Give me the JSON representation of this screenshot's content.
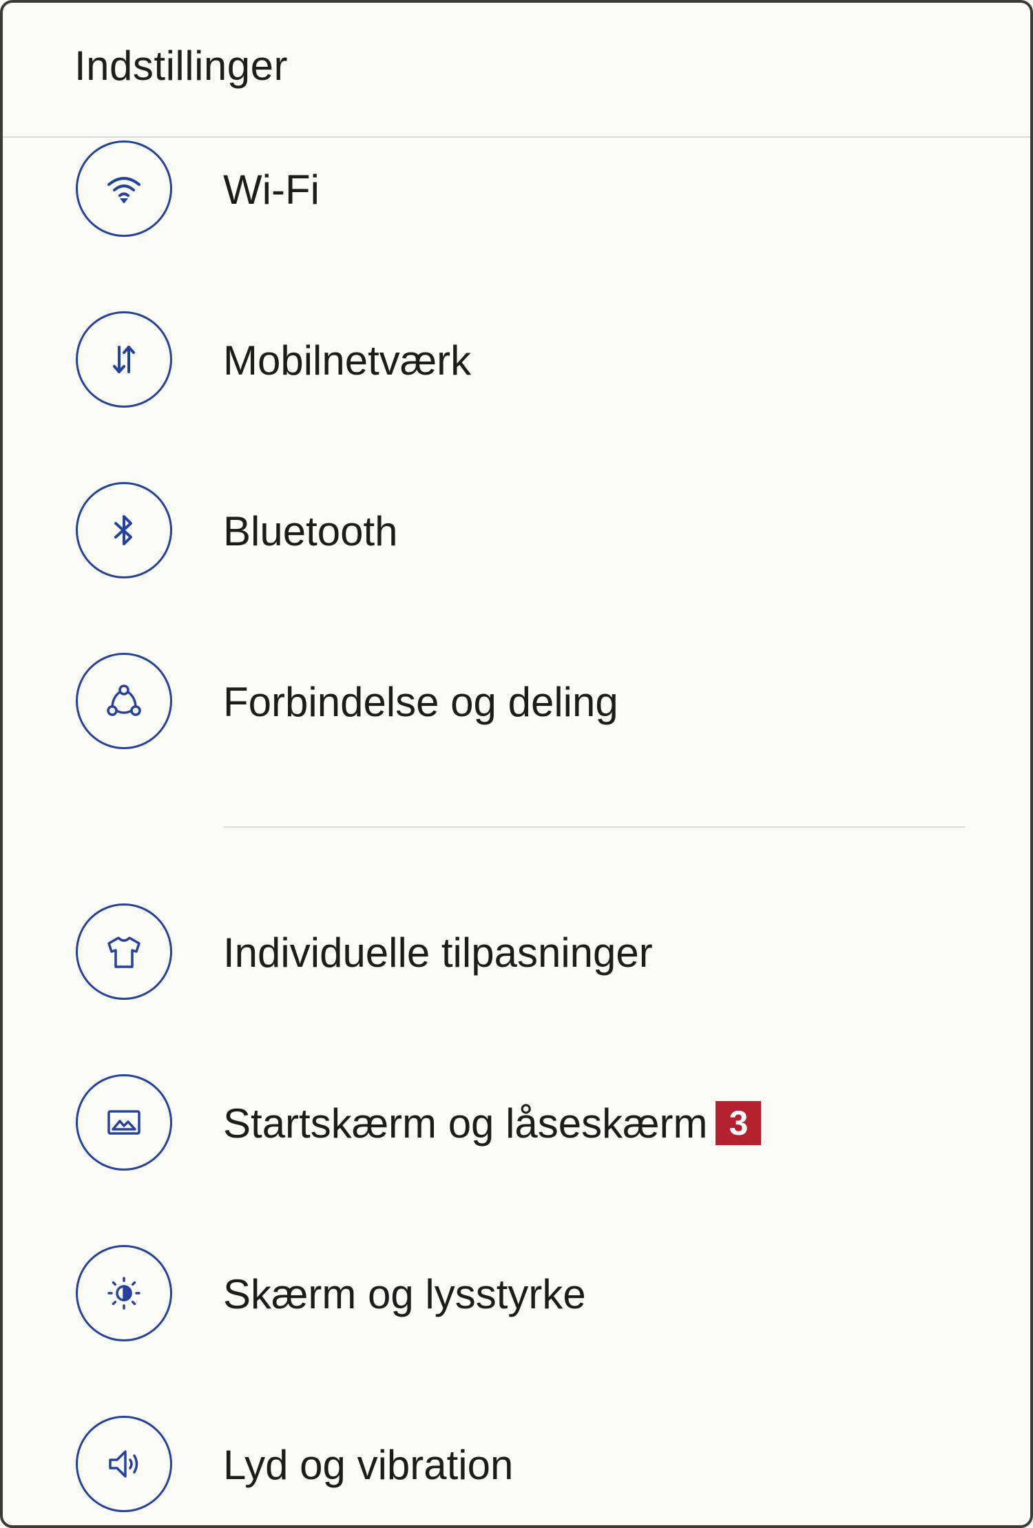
{
  "header": {
    "title": "Indstillinger"
  },
  "colors": {
    "icon_accent": "#24429b",
    "badge_bg": "#b3202e",
    "background": "#fafaf7"
  },
  "settings": {
    "items": [
      {
        "label": "Wi-Fi",
        "icon": "wifi-icon"
      },
      {
        "label": "Mobilnetværk",
        "icon": "mobile-data-icon"
      },
      {
        "label": "Bluetooth",
        "icon": "bluetooth-icon"
      },
      {
        "label": "Forbindelse og deling",
        "icon": "connection-sharing-icon"
      },
      {
        "label": "Individuelle tilpasninger",
        "icon": "tshirt-icon"
      },
      {
        "label": "Startskærm og låseskærm",
        "icon": "wallpaper-icon",
        "badge": "3"
      },
      {
        "label": "Skærm og lysstyrke",
        "icon": "brightness-icon"
      },
      {
        "label": "Lyd og vibration",
        "icon": "speaker-icon"
      }
    ]
  }
}
